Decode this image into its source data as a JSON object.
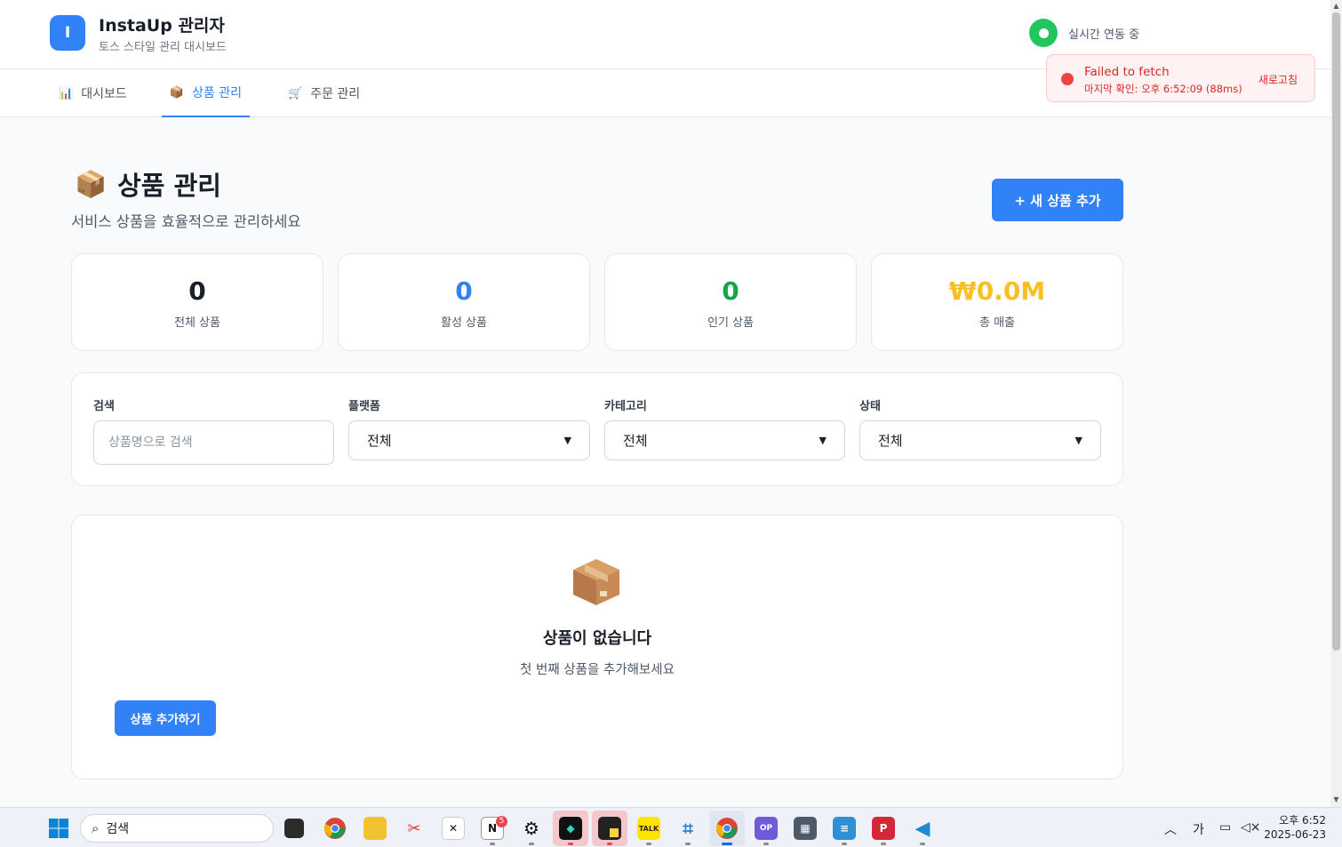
{
  "header": {
    "logo_letter": "I",
    "title": "InstaUp 관리자",
    "subtitle": "토스 스타일 관리 대시보드",
    "live_status": "실시간 연동 중"
  },
  "nav": {
    "tabs": [
      {
        "icon": "📊",
        "label": "대시보드",
        "active": false
      },
      {
        "icon": "📦",
        "label": "상품 관리",
        "active": true
      },
      {
        "icon": "🛒",
        "label": "주문 관리",
        "active": false
      }
    ]
  },
  "toast": {
    "title": "Failed to fetch",
    "detail": "마지막 확인: 오후 6:52:09 (88ms)",
    "action": "새로고침"
  },
  "page": {
    "icon": "📦",
    "title": "상품 관리",
    "subtitle": "서비스 상품을 효율적으로 관리하세요",
    "add_button": "+ 새 상품 추가"
  },
  "stats": [
    {
      "value": "0",
      "label": "전체 상품",
      "color": "#191f28"
    },
    {
      "value": "0",
      "label": "활성 상품",
      "color": "#3182f6"
    },
    {
      "value": "0",
      "label": "인기 상품",
      "color": "#16a34a"
    },
    {
      "value": "₩0.0M",
      "label": "총 매출",
      "color": "#fbbf24"
    }
  ],
  "filters": {
    "search_label": "검색",
    "search_placeholder": "상품명으로 검색",
    "platform_label": "플랫폼",
    "platform_value": "전체",
    "category_label": "카테고리",
    "category_value": "전체",
    "status_label": "상태",
    "status_value": "전체"
  },
  "empty": {
    "title": "상품이 없습니다",
    "subtitle": "첫 번째 상품을 추가해보세요",
    "button": "상품 추가하기"
  },
  "taskbar": {
    "search_text": "검색",
    "ime": "가",
    "time": "오후 6:52",
    "date": "2025-06-23",
    "notion_badge": "5",
    "apps": [
      "start-icon",
      "task-view-icon",
      "chrome-icon",
      "file-explorer-icon",
      "snipping-tool-icon",
      "capcut-icon",
      "notion-icon",
      "chatgpt-icon",
      "app-icon",
      "sticky-notes-icon",
      "kakaotalk-icon",
      "network-app-icon",
      "chrome-profile-icon",
      "opgg-icon",
      "calculator-icon",
      "notepad-icon",
      "pdf-icon",
      "vscode-icon"
    ]
  }
}
